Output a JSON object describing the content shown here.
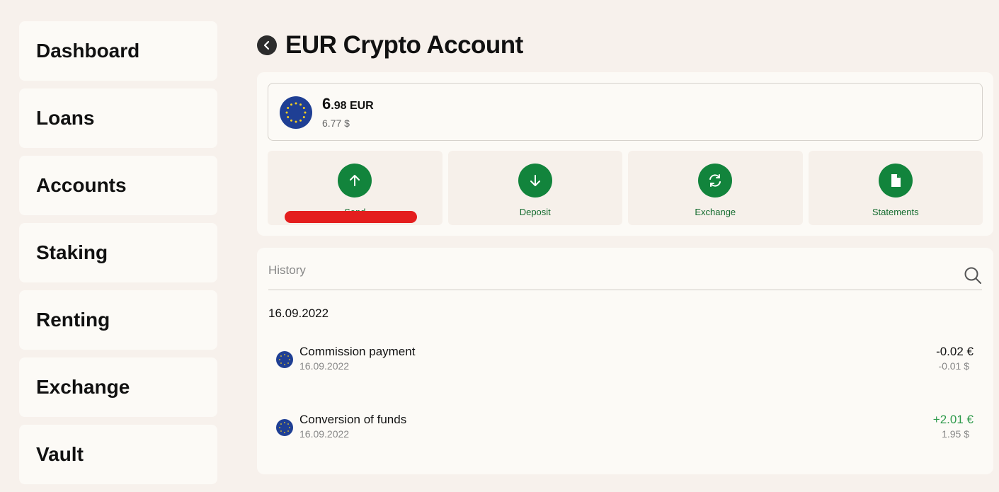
{
  "sidebar": {
    "items": [
      {
        "label": "Dashboard"
      },
      {
        "label": "Loans"
      },
      {
        "label": "Accounts"
      },
      {
        "label": "Staking"
      },
      {
        "label": "Renting"
      },
      {
        "label": "Exchange"
      },
      {
        "label": "Vault"
      }
    ]
  },
  "header": {
    "back_icon": "chevron-left-icon",
    "title": "EUR Crypto Account"
  },
  "balance": {
    "flag_icon": "eu-flag-icon",
    "integer": "6",
    "decimal": ".98",
    "currency": "EUR",
    "usd": "6.77 $"
  },
  "actions": [
    {
      "label": "Send",
      "icon": "arrow-up-icon"
    },
    {
      "label": "Deposit",
      "icon": "arrow-down-icon"
    },
    {
      "label": "Exchange",
      "icon": "exchange-icon"
    },
    {
      "label": "Statements",
      "icon": "document-icon"
    }
  ],
  "history": {
    "label": "History",
    "search_icon": "search-icon",
    "date_group": "16.09.2022",
    "transactions": [
      {
        "title": "Commission payment",
        "date": "16.09.2022",
        "amount": "-0.02 €",
        "usd": "-0.01 $",
        "type": "debit"
      },
      {
        "title": "Conversion of funds",
        "date": "16.09.2022",
        "amount": "+2.01 €",
        "usd": "1.95 $",
        "type": "credit"
      }
    ]
  },
  "colors": {
    "background": "#f7f1ec",
    "card": "#fcfaf6",
    "accent_green": "#12843c",
    "positive": "#2e9a4b",
    "annotation_red": "#e41e1e"
  }
}
